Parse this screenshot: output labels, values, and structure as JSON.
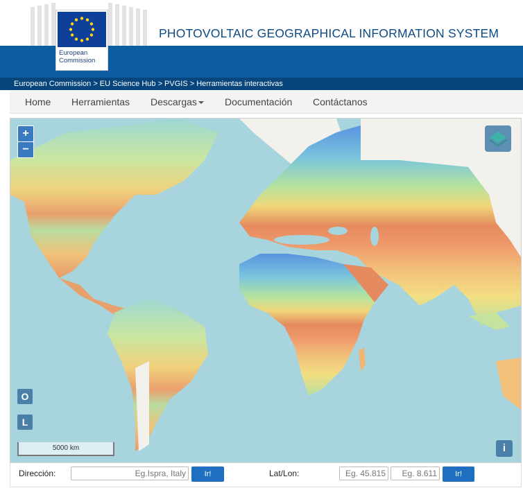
{
  "logo": {
    "text": "European\nCommission",
    "flag_color": "#0e3f99"
  },
  "header": {
    "title": "PHOTOVOLTAIC GEOGRAPHICAL INFORMATION SYSTEM"
  },
  "breadcrumb": "European Commission > EU Science Hub > PVGIS > Herramientas interactivas",
  "nav": {
    "items": [
      {
        "label": "Home"
      },
      {
        "label": "Herramientas"
      },
      {
        "label": "Descargas"
      },
      {
        "label": "Documentación"
      },
      {
        "label": "Contáctanos"
      }
    ]
  },
  "map": {
    "zoom_in": "+",
    "zoom_out": "−",
    "btn_o": "O",
    "btn_l": "L",
    "scale_label": "5000 km",
    "info": "i",
    "icons": {
      "layers": "layers-icon"
    }
  },
  "search": {
    "address_label": "Dirección:",
    "address_placeholder": "Eg.Ispra, Italy",
    "go1": "Ir!",
    "latlon_label": "Lat/Lon:",
    "lat_placeholder": "Eg. 45.815",
    "lon_placeholder": "Eg. 8.611",
    "go2": "Ir!"
  },
  "colors": {
    "accent": "#0c5da1",
    "dark": "#07467c",
    "ocean": "#a8d4dd"
  }
}
